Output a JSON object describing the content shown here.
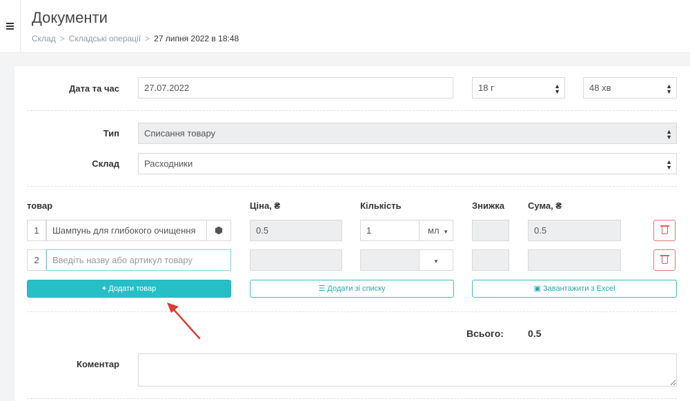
{
  "header": {
    "title": "Документи",
    "breadcrumb": [
      "Склад",
      "Складські операції",
      "27 липня 2022 в 18:48"
    ]
  },
  "form": {
    "datetime_label": "Дата та час",
    "date_value": "27.07.2022",
    "hour_value": "18 г",
    "minute_value": "48 хв",
    "type_label": "Тип",
    "type_value": "Списання товару",
    "warehouse_label": "Склад",
    "warehouse_value": "Расходники"
  },
  "table": {
    "headers": {
      "product": "товар",
      "price": "Ціна, ₴",
      "quantity": "Кількість",
      "discount": "Знижка",
      "sum": "Сума, ₴"
    },
    "rows": [
      {
        "num": "1",
        "product": "Шампунь для глибокого очищення",
        "price": "0.5",
        "quantity": "1",
        "unit": "мл",
        "discount": "",
        "sum": "0.5"
      },
      {
        "num": "2",
        "product_placeholder": "Введіть назву або артикул товару",
        "price": "",
        "quantity": "",
        "unit": "",
        "discount": "",
        "sum": ""
      }
    ]
  },
  "buttons": {
    "add_product": "Додати товар",
    "add_from_list": "Додати зі списку",
    "upload_excel": "Завантажити з Excel"
  },
  "totals": {
    "label": "Всього:",
    "value": "0.5"
  },
  "comment": {
    "label": "Коментар",
    "value": ""
  },
  "colors": {
    "accent": "#26bfc5",
    "danger": "#e05a5a",
    "arrow": "#e53935"
  }
}
